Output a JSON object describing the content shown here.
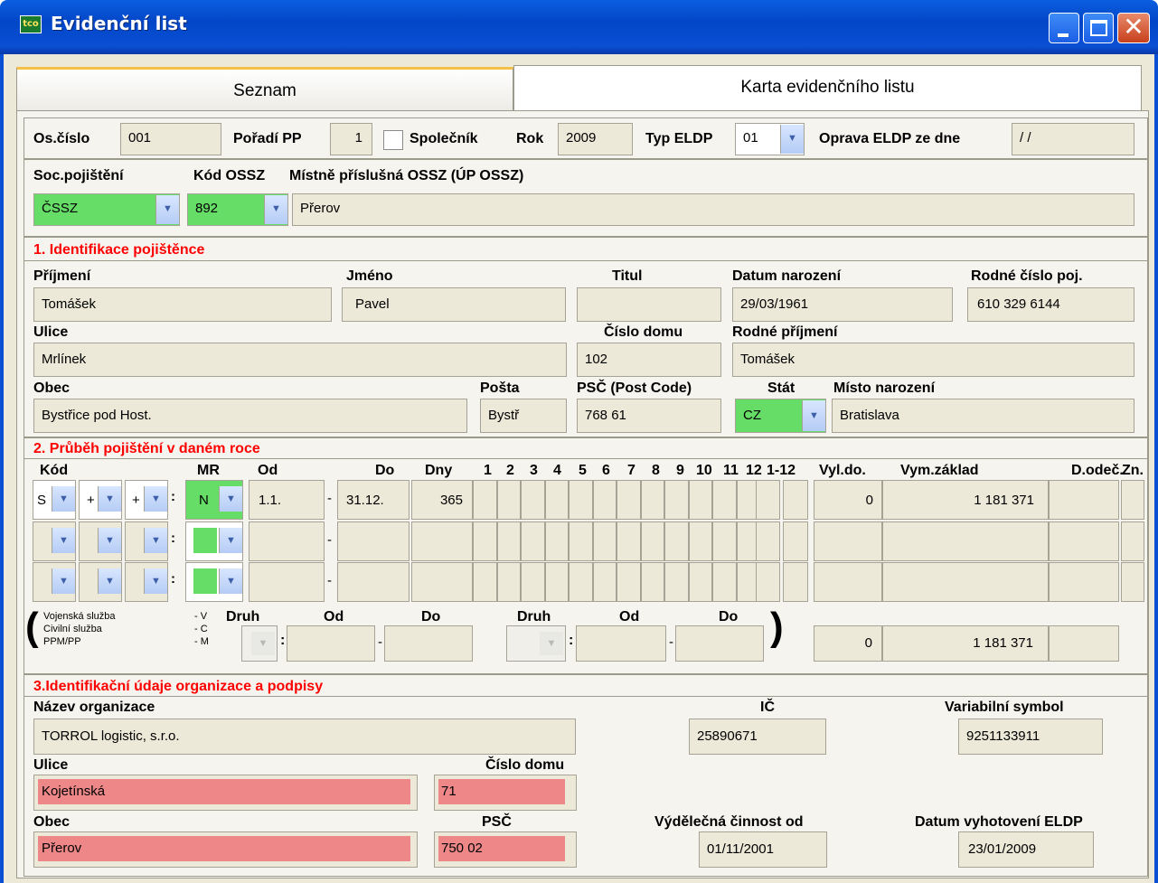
{
  "window": {
    "title": "Evidenční list",
    "icon_text": "tco",
    "controls": [
      "minimize-icon",
      "maximize-icon",
      "close-icon"
    ]
  },
  "tabs": [
    "Seznam",
    "Karta evidenčního listu"
  ],
  "header": {
    "os_cislo_label": "Os.číslo",
    "os_cislo": "001",
    "poradi_label": "Pořadí PP",
    "poradi": "1",
    "spolecnik_label": "Společník",
    "rok_label": "Rok",
    "rok": "2009",
    "typ_label": "Typ ELDP",
    "typ": "01",
    "oprava_label": "Oprava ELDP ze dne",
    "oprava": "/ /"
  },
  "social": {
    "soc_label": "Soc.pojištění",
    "kod_label": "Kód OSSZ",
    "mistne_label": "Místně příslušná OSSZ (ÚP OSSZ)",
    "soc": "ČSSZ",
    "kod": "892",
    "mistne": "Přerov"
  },
  "s1": {
    "heading": "1. Identifikace pojištěnce",
    "prijmeni_label": "Příjmení",
    "prijmeni": "Tomášek",
    "jmeno_label": "Jméno",
    "jmeno": "Pavel",
    "titul_label": "Titul",
    "titul": "",
    "datum_label": "Datum narození",
    "datum": "29/03/1961",
    "rodne_label": "Rodné číslo poj.",
    "rodne": "610 329 6144",
    "ulice_label": "Ulice",
    "ulice": "Mrlínek",
    "cislo_label": "Číslo domu",
    "cislo": "102",
    "rodne_prijmeni_label": "Rodné příjmení",
    "rodne_prijmeni": "Tomášek",
    "obec_label": "Obec",
    "obec": "Bystřice pod Host.",
    "posta_label": "Pošta",
    "posta": "Bystř",
    "psc_label": "PSČ (Post Code)",
    "psc": "768 61",
    "stat_label": "Stát",
    "stat": "CZ",
    "misto_label": "Místo narození",
    "misto": "Bratislava"
  },
  "s2": {
    "heading": "2. Průběh pojištění v daném roce",
    "cols": {
      "kod": "Kód",
      "mr": "MR",
      "od": "Od",
      "do": "Do",
      "dny": "Dny",
      "months": [
        "1",
        "2",
        "3",
        "4",
        "5",
        "6",
        "7",
        "8",
        "9",
        "10",
        "11",
        "12",
        "1-12"
      ],
      "vyl": "Vyl.do.",
      "vym": "Vym.základ",
      "odec": "D.odeč.",
      "zn": "Zn."
    },
    "row1": {
      "k1": "S",
      "k2": "+",
      "k3": "+",
      "mr": "N",
      "od": "1.1.",
      "do": "31.12.",
      "dny": "365",
      "vyl": "0",
      "vym": "1 181 371"
    },
    "mil": {
      "l1": "Vojenská služba",
      "l2": "Civilní služba",
      "l3": "PPM/PP",
      "c1": "- V",
      "c2": "- C",
      "c3": "- M",
      "druh": "Druh",
      "od": "Od",
      "do": "Do"
    },
    "totals": {
      "vyl": "0",
      "vym": "1 181 371"
    }
  },
  "s3": {
    "heading": "3.Identifikační údaje organizace a podpisy",
    "nazev_label": "Název organizace",
    "nazev": "TORROL logistic, s.r.o.",
    "ic_label": "IČ",
    "ic": "25890671",
    "vs_label": "Variabilní symbol",
    "vs": "9251133911",
    "ulice_label": "Ulice",
    "ulice": "Kojetínská",
    "cislo_label": "Číslo domu",
    "cislo": "71",
    "obec_label": "Obec",
    "obec": "Přerov",
    "psc_label": "PSČ",
    "psc": "750 02",
    "vyd_label": "Výdělečná činnost od",
    "vyd": "01/11/2001",
    "dat_label": "Datum vyhotovení ELDP",
    "dat": "23/01/2009"
  }
}
